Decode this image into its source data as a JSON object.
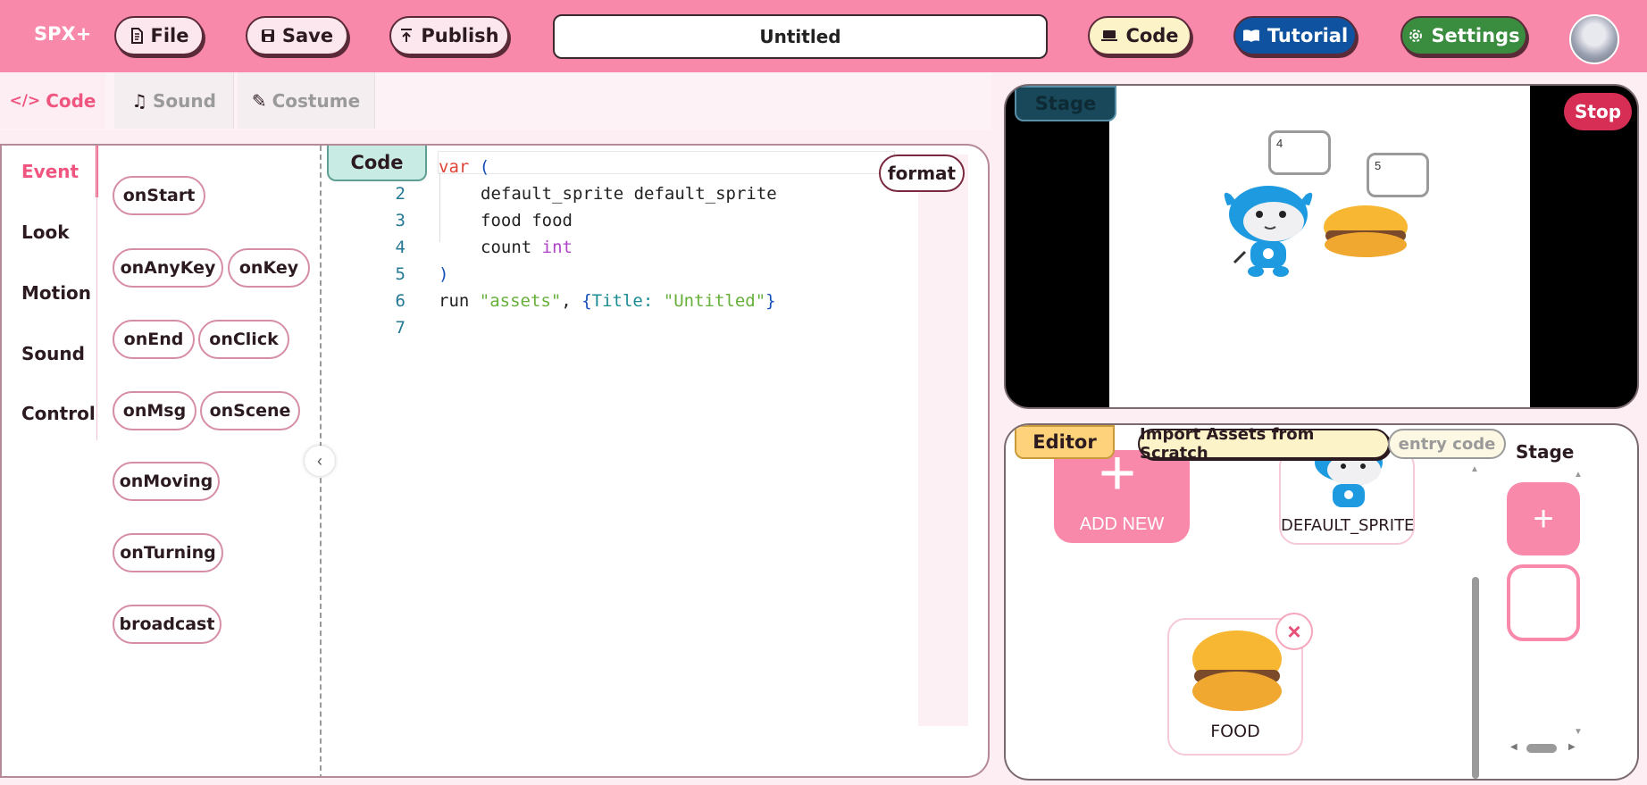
{
  "header": {
    "logo": "SPX+",
    "file_label": "File",
    "save_label": "Save",
    "publish_label": "Publish",
    "project_title": "Untitled",
    "code_label": "Code",
    "tutorial_label": "Tutorial",
    "settings_label": "Settings"
  },
  "tabs": [
    {
      "label": "Code",
      "icon": "code-icon"
    },
    {
      "label": "Sound",
      "icon": "music-note-icon"
    },
    {
      "label": "Costume",
      "icon": "brush-icon"
    }
  ],
  "categories": [
    "Event",
    "Look",
    "Motion",
    "Sound",
    "Control"
  ],
  "blocks": [
    "onStart",
    "onAnyKey",
    "onKey",
    "onEnd",
    "onClick",
    "onMsg",
    "onScene",
    "onMoving",
    "onTurning",
    "broadcast"
  ],
  "editor": {
    "label": "Code",
    "format_label": "format",
    "line_numbers": [
      "2",
      "3",
      "4",
      "5",
      "6",
      "7"
    ],
    "code": {
      "var_kw": "var",
      "open_paren": "(",
      "l2": "default_sprite default_sprite",
      "l3": "food food",
      "l4_name": "count",
      "l4_type": "int",
      "close_paren": ")",
      "run": "run",
      "assets_str": "\"assets\"",
      "comma": ",",
      "open_brace": "{",
      "title_key": "Title",
      "colon": ":",
      "title_val": "\"Untitled\"",
      "close_brace": "}"
    }
  },
  "stage": {
    "label": "Stage",
    "stop_label": "Stop",
    "bubble1": "4",
    "bubble2": "5"
  },
  "sprite_editor": {
    "label": "Editor",
    "import_label": "Import Assets from Scratch",
    "entry_label": "entry code",
    "add_new_label": "ADD NEW",
    "sprites": [
      "DEFAULT_SPRITE",
      "FOOD"
    ],
    "side_stage_label": "Stage"
  },
  "colors": {
    "brand_pink": "#f989ab",
    "accent": "#f0557f",
    "stop": "#d62e55",
    "tutorial": "#0f52a0",
    "settings": "#3a8c3f"
  }
}
